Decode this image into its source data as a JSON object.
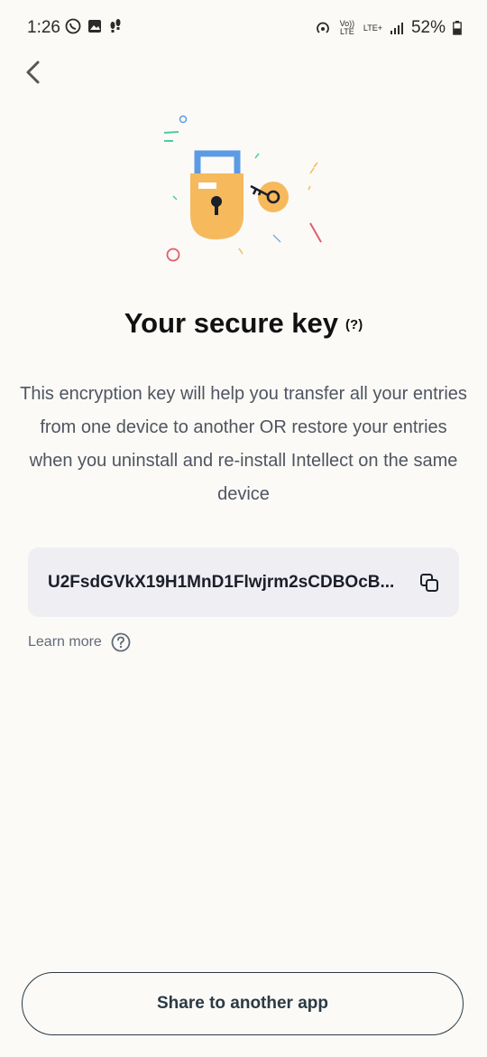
{
  "status_bar": {
    "time": "1:26",
    "volte": "Vo)) LTE",
    "network": "LTE+",
    "battery": "52%"
  },
  "header": {
    "back_icon": "chevron-left-icon"
  },
  "title": "Your secure key",
  "title_help": "(?)",
  "description": "This encryption key will help you transfer all your entries from one device to another OR restore your entries when you uninstall and re-install Intellect on the same device",
  "key": {
    "value": "U2FsdGVkX19H1MnD1Flwjrm2sCDBOcB...",
    "copy_icon": "copy-icon"
  },
  "learn_more": {
    "label": "Learn more",
    "icon": "help-circle-icon"
  },
  "share_button": "Share to another app",
  "colors": {
    "background": "#fbfaf7",
    "lock_body": "#f6b95c",
    "lock_shackle": "#5b9be6",
    "key_box": "#efeff3",
    "button_border": "#2b3a44"
  }
}
